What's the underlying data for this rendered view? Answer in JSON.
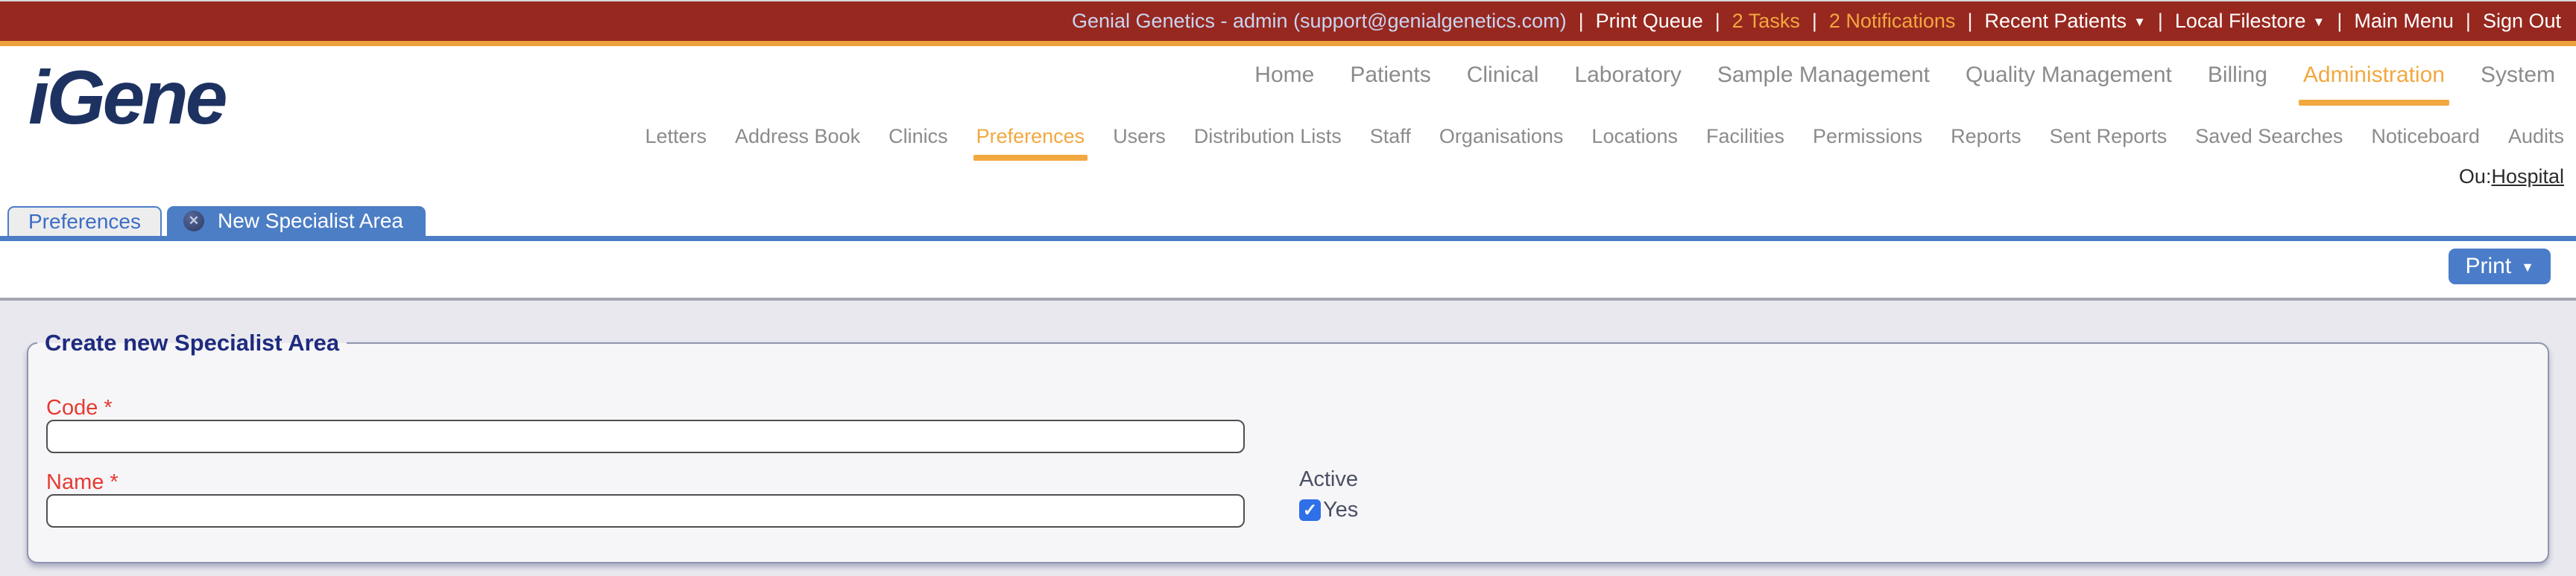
{
  "topbar": {
    "user": "Genial Genetics - admin (support@genialgenetics.com)",
    "separator": "|",
    "items": [
      {
        "label": "Print Queue"
      },
      {
        "label": "2 Tasks",
        "highlight": true
      },
      {
        "label": "2 Notifications",
        "highlight": true
      },
      {
        "label": "Recent Patients",
        "dropdown": true
      },
      {
        "label": "Local Filestore",
        "dropdown": true
      },
      {
        "label": "Main Menu"
      },
      {
        "label": "Sign Out"
      }
    ]
  },
  "header": {
    "logo": "iGene",
    "main_nav": [
      {
        "label": "Home"
      },
      {
        "label": "Patients"
      },
      {
        "label": "Clinical"
      },
      {
        "label": "Laboratory"
      },
      {
        "label": "Sample Management"
      },
      {
        "label": "Quality Management"
      },
      {
        "label": "Billing"
      },
      {
        "label": "Administration",
        "active": true
      },
      {
        "label": "System"
      }
    ],
    "sub_nav": [
      {
        "label": "Letters"
      },
      {
        "label": "Address Book"
      },
      {
        "label": "Clinics"
      },
      {
        "label": "Preferences",
        "active": true
      },
      {
        "label": "Users"
      },
      {
        "label": "Distribution Lists"
      },
      {
        "label": "Staff"
      },
      {
        "label": "Organisations"
      },
      {
        "label": "Locations"
      },
      {
        "label": "Facilities"
      },
      {
        "label": "Permissions"
      },
      {
        "label": "Reports"
      },
      {
        "label": "Sent Reports"
      },
      {
        "label": "Saved Searches"
      },
      {
        "label": "Noticeboard"
      },
      {
        "label": "Audits"
      }
    ],
    "ou_label": "Ou:",
    "ou_value": "Hospital"
  },
  "tabs": [
    {
      "label": "Preferences",
      "active": false
    },
    {
      "label": "New Specialist Area",
      "active": true,
      "closable": true
    }
  ],
  "toolbar": {
    "print_label": "Print"
  },
  "form": {
    "legend": "Create new Specialist Area",
    "required_marker": "*",
    "fields": [
      {
        "label": "Code",
        "required": true,
        "value": ""
      },
      {
        "label": "Name",
        "required": true,
        "value": ""
      }
    ],
    "active": {
      "label": "Active",
      "checkbox_label": "Yes",
      "checked": true
    }
  },
  "icons": {
    "caret_down": "▼",
    "close": "✕",
    "check": "✓"
  },
  "colors": {
    "topbar_bg": "#97281f",
    "topbar_accent_border": "#eda13b",
    "topbar_user_text": "#c9d5f2",
    "highlight_orange": "#f2a840",
    "nav_gray": "#8b8b8b",
    "tab_blue": "#4c7ec5",
    "link_blue": "#3c6cc4",
    "legend_navy": "#1e2b7e",
    "required_red": "#e8392f",
    "checkbox_blue": "#2f70e8",
    "content_bg": "#e8e8ee",
    "panel_bg": "#f6f6f9"
  }
}
